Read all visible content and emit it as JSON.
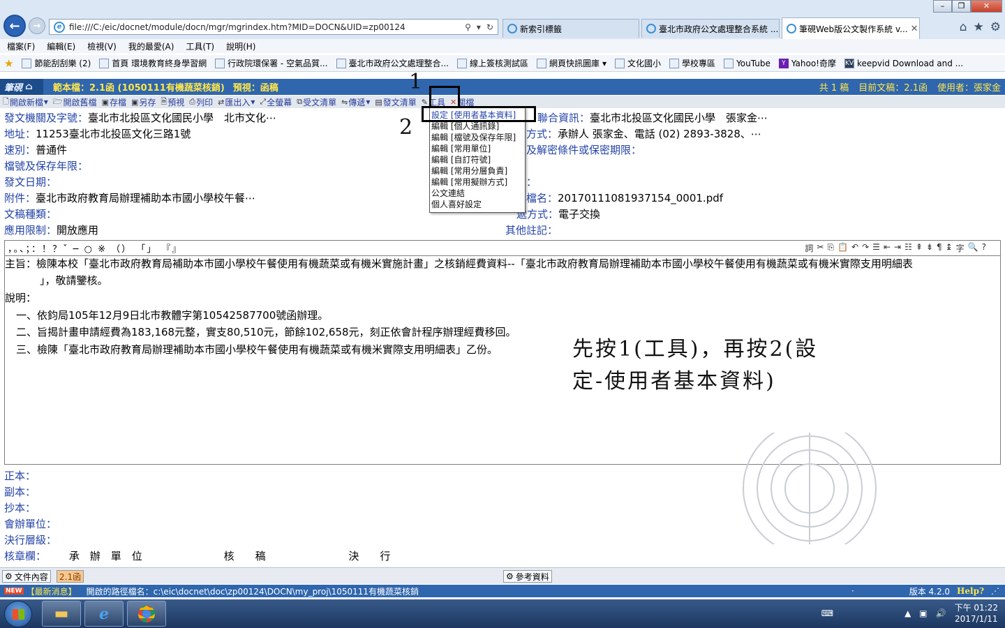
{
  "browser": {
    "address": "file:///C:/eic/docnet/module/docn/mgr/mgrindex.htm?MID=DOCN&UID=zp00124",
    "tabs": [
      "新索引標籤",
      "臺北市政府公文處理整合系統 ...",
      "筆硯Web版公文製作系統 v..."
    ],
    "menu": [
      "檔案(F)",
      "編輯(E)",
      "檢視(V)",
      "我的最愛(A)",
      "工具(T)",
      "說明(H)"
    ],
    "favorites": [
      "節能刮刮樂 (2)",
      "首頁 環境教育終身學習網",
      "行政院環保署 - 空氣品質...",
      "臺北市政府公文處理整合...",
      "線上簽核測試區",
      "網頁快訊圖庫",
      "文化國小",
      "學校專區",
      "YouTube",
      "Yahoo!奇摩",
      "keepvid Download and ..."
    ]
  },
  "app": {
    "logo": "筆硯",
    "template_label": "範本檔：2.1函 (1050111有機蔬菜核銷)",
    "preview_label": "預視：函稿",
    "count": "共 1 稿",
    "current_doc": "目前文稿：2.1函",
    "user": "使用者：張家金",
    "toolbar": [
      "開啟新檔",
      "開啟舊檔",
      "存檔",
      "另存",
      "預視",
      "列印",
      "匯出入",
      "全螢幕",
      "受文清單",
      "傳遞",
      "發文清單",
      "工具",
      "關檔"
    ]
  },
  "tools_menu": [
    "設定 [使用者基本資料]",
    "編輯 [個人通訊錄]",
    "編輯 [檔號及保存年限]",
    "編輯 [常用單位]",
    "編輯 [自訂符號]",
    "編輯 [常用分層負責]",
    "編輯 [常用擬辦方式]",
    "公文連結",
    "個人喜好設定"
  ],
  "form_left": [
    {
      "label": "發文機關及字號：",
      "value": "臺北市北投區文化國民小學　北市文化⋯"
    },
    {
      "label": "地址：",
      "value": "11253臺北市北投區文化三路1號"
    },
    {
      "label": "速別：",
      "value": "普通件"
    },
    {
      "label": "檔號及保存年限：",
      "value": ""
    },
    {
      "label": "發文日期：",
      "value": ""
    },
    {
      "label": "附件：",
      "value": "臺北市政府教育局辦理補助本市國小學校午餐⋯"
    },
    {
      "label": "文稿種類：",
      "value": ""
    },
    {
      "label": "應用限制：",
      "value": "開放應用"
    }
  ],
  "form_right": [
    {
      "label": "聯合資訊：",
      "value": "臺北市北投區文化國民小學　張家金⋯"
    },
    {
      "label": "方式：",
      "value": "承辦人 張家金、電話 (02) 2893-3828、⋯"
    },
    {
      "label": "及解密條件或保密期限：",
      "value": ""
    },
    {
      "label": "",
      "value": ""
    },
    {
      "label": "：",
      "value": ""
    },
    {
      "label": "檔名：",
      "value": "20170111081937154_0001.pdf"
    },
    {
      "label": "遞方式：",
      "value": "電子交換"
    },
    {
      "label": "其他註記：",
      "value": ""
    }
  ],
  "punctuation": "，。、；：！？ˇ ─ ○ ※ （） 「」 『』",
  "editor_tools": [
    "詞",
    "✂",
    "⎘",
    "📋",
    "↶",
    "↷",
    "☰",
    "⇤",
    "⇥",
    "☷",
    "⇞",
    "⇟",
    "¶",
    "↨",
    "字",
    "🔍",
    "?"
  ],
  "body": {
    "subject_1": "主旨：檢陳本校「臺北市政府教育局補助本市國小學校午餐使用有機蔬菜或有機米實施計畫」之核銷經費資料--「臺北市政府教育局辦理補助本市國小學校午餐使用有機蔬菜或有機米實際支用明細表",
    "subject_2": "」，敬請鑒核。",
    "explain": "說明：",
    "item_1": "一、依鈞局105年12月9日北市教體字第10542587700號函辦理。",
    "item_2": "二、旨揭計畫申請經費為183,168元整，實支80,510元，節餘102,658元，刻正依會計程序辦理經費移回。",
    "item_3": "三、檢陳「臺北市政府教育局辦理補助本市國小學校午餐使用有機蔬菜或有機米實際支用明細表」乙份。"
  },
  "annotation_line1": "先按1(工具)，再按2(設",
  "annotation_line2": "定-使用者基本資料)",
  "step1": "1",
  "step2": "2",
  "recipients": [
    {
      "label": "正本：",
      "value": ""
    },
    {
      "label": "副本：",
      "value": ""
    },
    {
      "label": "抄本：",
      "value": ""
    },
    {
      "label": "會辦單位：",
      "value": ""
    },
    {
      "label": "決行層級：",
      "value": ""
    }
  ],
  "sign_row": {
    "label": "核章欄：",
    "col1": "承　辦　單　位",
    "col2": "核　　稿",
    "col3": "決　　行"
  },
  "bottom": {
    "tab_content": "文件內容",
    "tab_doc": "2.1函",
    "reference": "參考資料",
    "news_badge": "NEW",
    "news_label": "【最新消息】",
    "path": "開啟的路徑檔名：c:\\eic\\docnet\\doc\\zp00124\\DOCN\\my_proj\\1050111有機蔬菜核銷",
    "dot": "·",
    "version": "版本 4.2.0",
    "help": "Help?"
  },
  "taskbar": {
    "time": "下午 01:22",
    "date": "2017/1/11"
  },
  "colors": {
    "header_blue": "#2f66ad",
    "label_blue": "#2343a8",
    "header_yellow": "#ffe64c"
  }
}
